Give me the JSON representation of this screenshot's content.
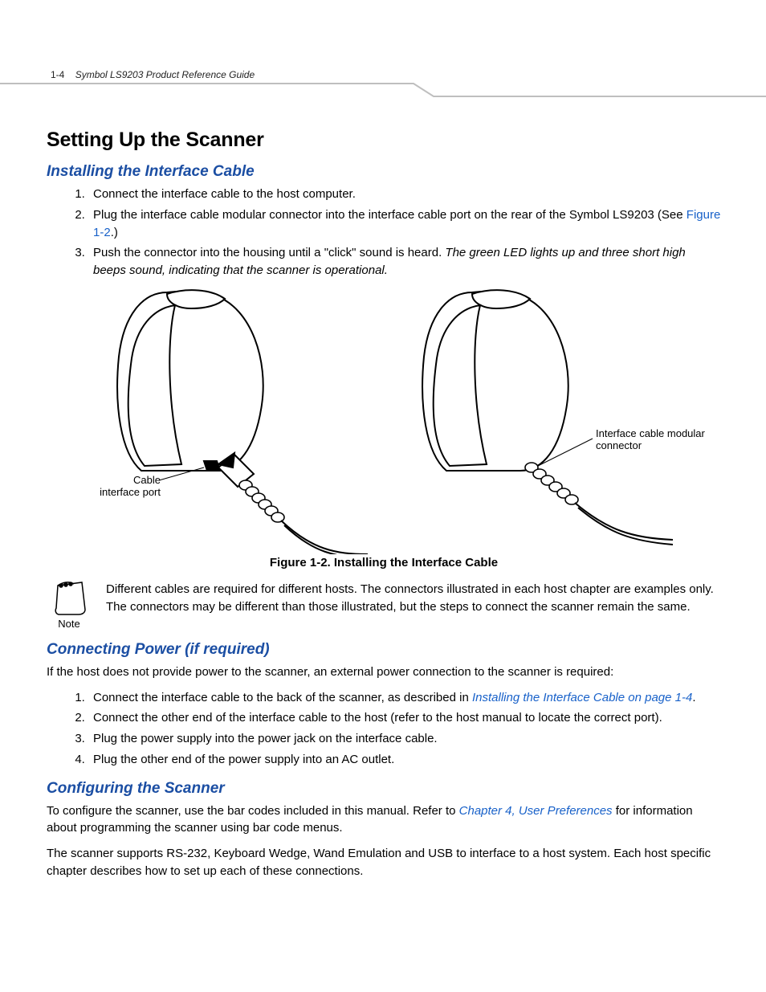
{
  "header": {
    "page_number": "1-4",
    "doc_title": "Symbol  LS9203 Product Reference Guide"
  },
  "section_title": "Setting Up the Scanner",
  "subsec_install": {
    "title": "Installing the Interface Cable",
    "steps": {
      "s1": "Connect the interface cable to the host computer.",
      "s2a": "Plug the interface cable modular connector into the interface cable port on the rear of the Symbol  LS9203 (See ",
      "s2_link": "Figure 1-2",
      "s2b": ".)",
      "s3a": "Push the connector into the housing until a \"click\" sound is heard. ",
      "s3_em": "The green LED lights up and three short high beeps sound, indicating that the scanner is operational."
    }
  },
  "figure": {
    "callout_left": "Cable interface port",
    "callout_right": "Interface cable modular connector",
    "caption": "Figure 1-2.  Installing the Interface Cable"
  },
  "note": {
    "label": "Note",
    "text": "Different cables are required for different hosts. The connectors illustrated in each host chapter are examples only. The connectors may be different than those illustrated, but the steps to connect the scanner remain the same."
  },
  "subsec_power": {
    "title": "Connecting Power (if required)",
    "intro": "If the host does not provide power to the scanner, an external power connection to the scanner is required:",
    "steps": {
      "s1a": "Connect the interface cable to the back of the scanner, as described in ",
      "s1_link": "Installing the Interface Cable on page 1-4",
      "s1b": ".",
      "s2": "Connect the other end of the interface cable to the host (refer to the host manual to locate the correct port).",
      "s3": "Plug the power supply into the power jack on the interface cable.",
      "s4": "Plug the other end of the power supply into an AC outlet."
    }
  },
  "subsec_config": {
    "title": "Configuring the Scanner",
    "p1a": "To configure the scanner, use the bar codes included in this manual. Refer to ",
    "p1_link": "Chapter 4, User Preferences",
    "p1b": " for information about programming the scanner using bar code menus.",
    "p2": "The scanner supports RS-232, Keyboard Wedge, Wand Emulation and USB to interface to a host system. Each host specific chapter describes how to set up each of these connections."
  }
}
